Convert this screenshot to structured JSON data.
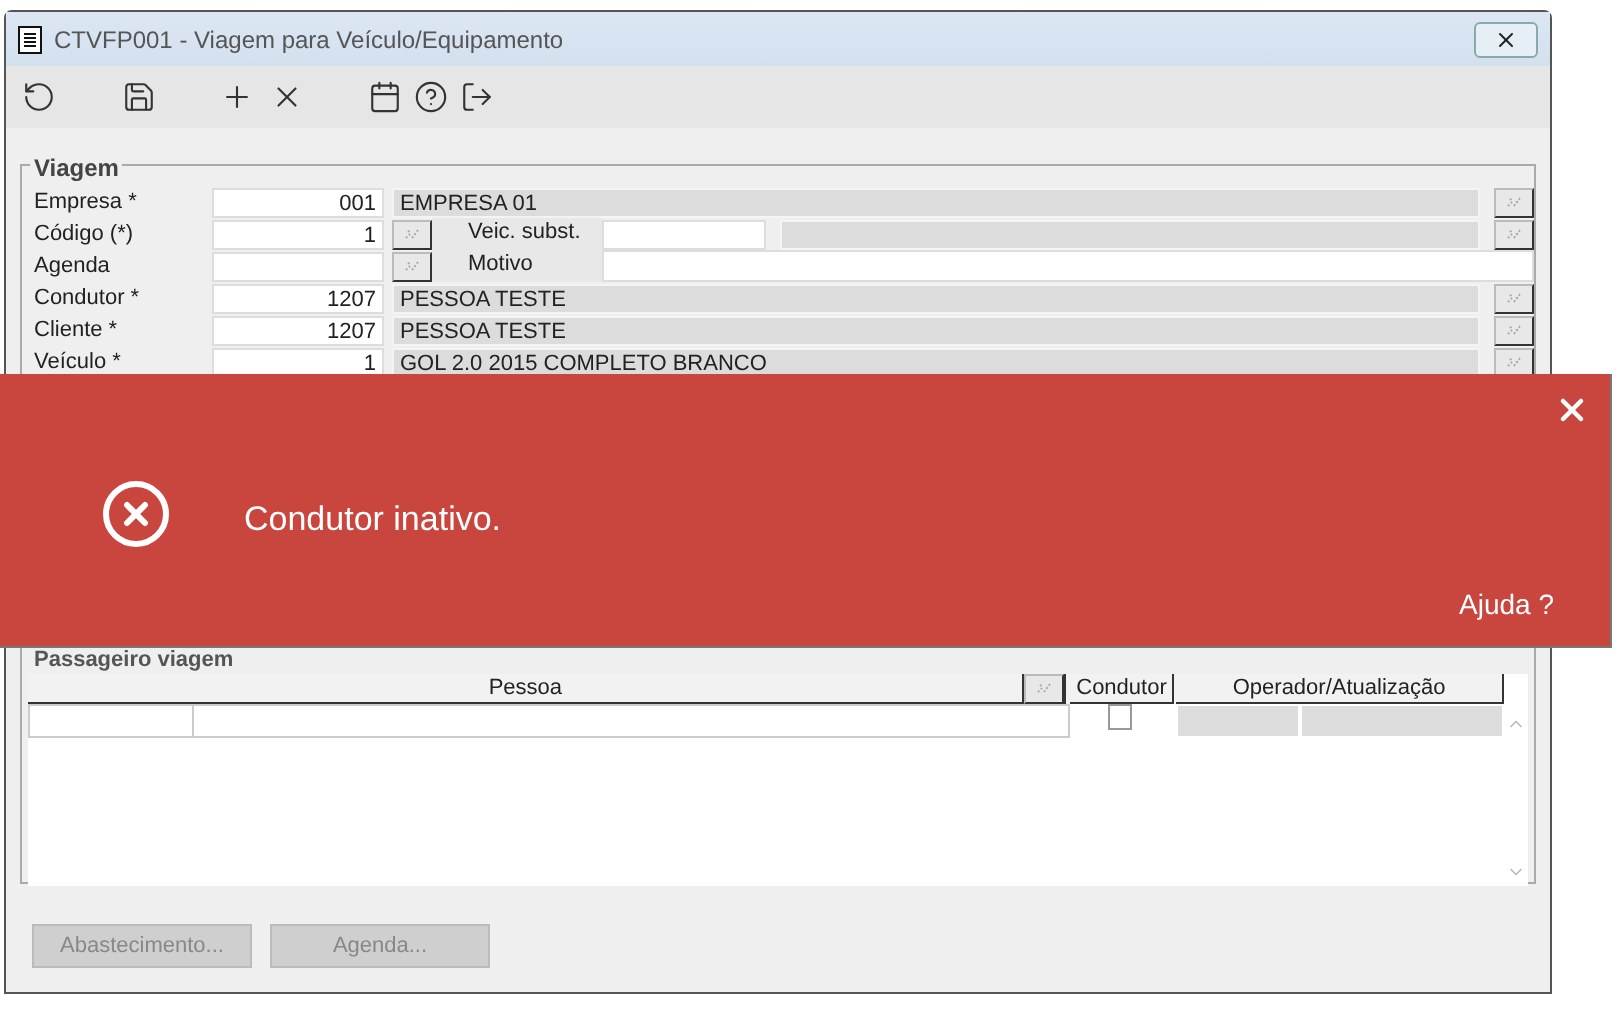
{
  "window": {
    "title": "CTVFP001 - Viagem para Veículo/Equipamento"
  },
  "viagem": {
    "title": "Viagem",
    "rows": [
      {
        "kind": "lookup",
        "label": "Empresa *",
        "code": "001",
        "description": "EMPRESA 01"
      },
      {
        "kind": "substitute",
        "label": "Código (*)",
        "code": "1",
        "sub_label": "Veic. subst."
      },
      {
        "kind": "motive",
        "label": "Agenda",
        "sub_label": "Motivo"
      },
      {
        "kind": "lookup",
        "label": "Condutor *",
        "code": "1207",
        "description": "PESSOA TESTE"
      },
      {
        "kind": "lookup",
        "label": "Cliente *",
        "code": "1207",
        "description": "PESSOA TESTE"
      },
      {
        "kind": "lookup",
        "label": "Veículo *",
        "code": "1",
        "description": "GOL 2.0 2015 COMPLETO BRANCO"
      }
    ]
  },
  "alert": {
    "message": "Condutor inativo.",
    "help": "Ajuda ?"
  },
  "passengers": {
    "title": "Passageiro viagem",
    "columns": [
      "Pessoa",
      "Condutor",
      "Operador/Atualização"
    ],
    "rows": [
      {
        "checked": false
      }
    ]
  },
  "buttons": [
    {
      "label": "Abastecimento...",
      "disabled": true
    },
    {
      "label": "Agenda...",
      "disabled": true
    }
  ]
}
